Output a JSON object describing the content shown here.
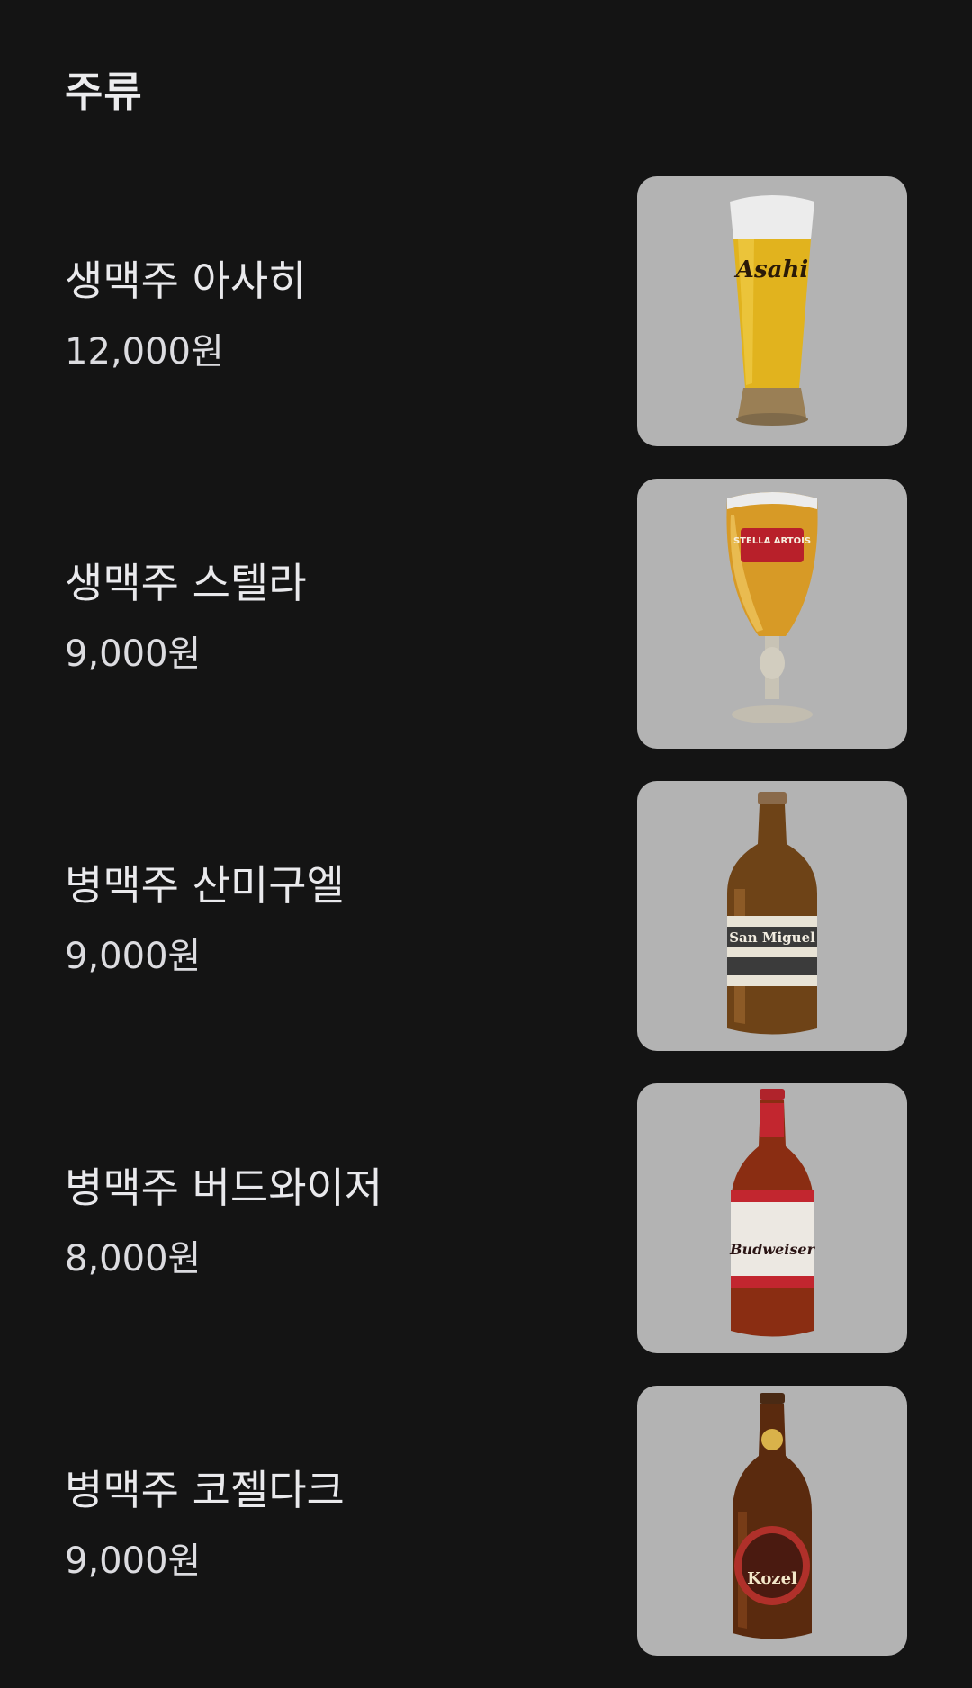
{
  "section": {
    "title": "주류"
  },
  "items": [
    {
      "name": "생맥주 아사히",
      "price": "12,000원",
      "image": "asahi-beer-glass-image",
      "label": "Asahi"
    },
    {
      "name": "생맥주 스텔라",
      "price": "9,000원",
      "image": "stella-artois-chalice-image",
      "label": "STELLA ARTOIS"
    },
    {
      "name": "병맥주 산미구엘",
      "price": "9,000원",
      "image": "san-miguel-bottle-image",
      "label": "San Miguel"
    },
    {
      "name": "병맥주 버드와이저",
      "price": "8,000원",
      "image": "budweiser-bottle-image",
      "label": "Budweiser"
    },
    {
      "name": "병맥주 코젤다크",
      "price": "9,000원",
      "image": "kozel-bottle-image",
      "label": "Kozel"
    }
  ],
  "colors": {
    "background": "#141414",
    "thumb_background": "#b3b3b3",
    "text": "#e9e9ec"
  }
}
